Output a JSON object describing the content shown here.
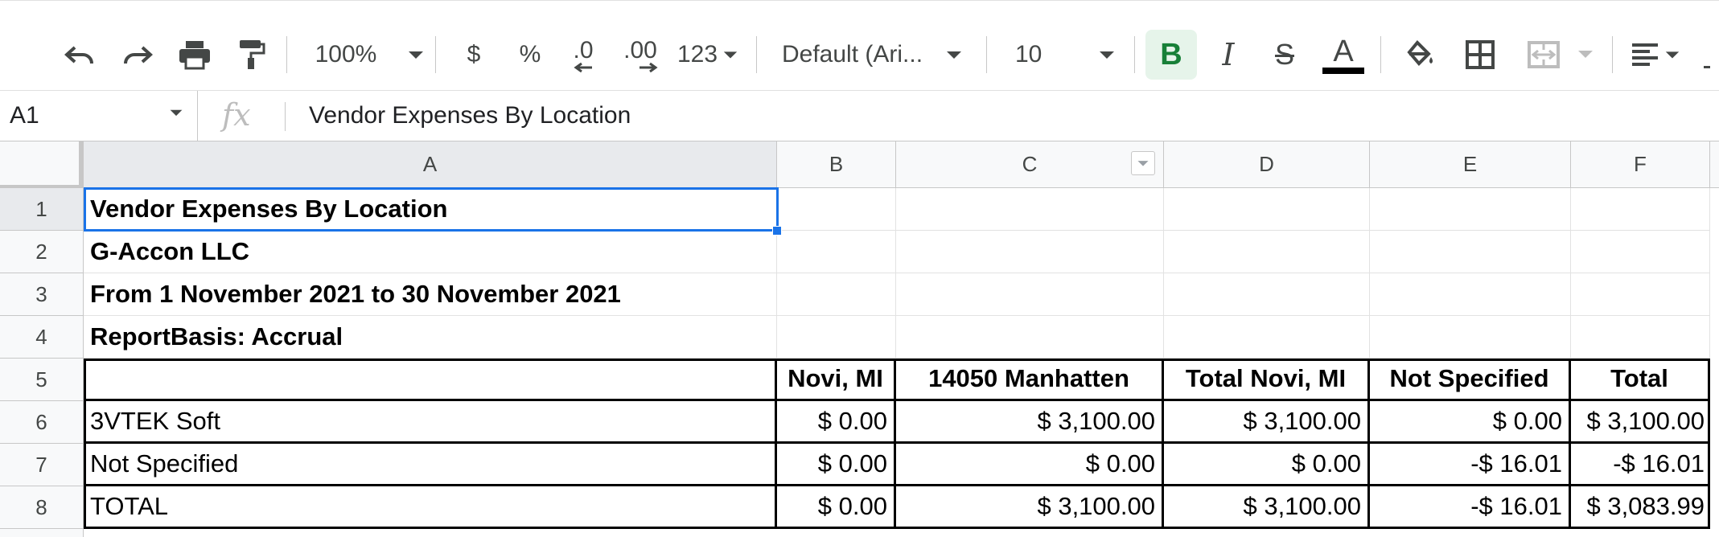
{
  "toolbar": {
    "zoom": "100%",
    "currency_label": "$",
    "percent_label": "%",
    "decrease_decimal_label": ".0",
    "increase_decimal_label": ".00",
    "more_formats_label": "123",
    "font_family": "Default (Ari...",
    "font_size": "10",
    "bold_label": "B",
    "italic_label": "I",
    "strike_label": "S",
    "text_color_label": "A",
    "colors": {
      "bold_active": "#188038",
      "text_color_bar": "#000000"
    }
  },
  "formula_bar": {
    "cell_ref": "A1",
    "fx_label": "fx",
    "value": "Vendor Expenses By Location"
  },
  "columns": [
    "A",
    "B",
    "C",
    "D",
    "E",
    "F"
  ],
  "rows": [
    "1",
    "2",
    "3",
    "4",
    "5",
    "6",
    "7",
    "8"
  ],
  "sheet": {
    "title": "Vendor Expenses By Location",
    "company": "G-Accon LLC",
    "period": "From 1 November 2021 to 30 November 2021",
    "basis": "ReportBasis: Accrual",
    "headers": [
      "",
      "Novi, MI",
      "14050 Manhatten",
      "Total Novi, MI",
      "Not Specified",
      "Total"
    ],
    "data": [
      [
        "3VTEK Soft",
        "$ 0.00",
        "$ 3,100.00",
        "$ 3,100.00",
        "$ 0.00",
        "$ 3,100.00"
      ],
      [
        "Not Specified",
        "$ 0.00",
        "$ 0.00",
        "$ 0.00",
        "-$ 16.01",
        "-$ 16.01"
      ],
      [
        "TOTAL",
        "$ 0.00",
        "$ 3,100.00",
        "$ 3,100.00",
        "-$ 16.01",
        "$ 3,083.99"
      ]
    ]
  },
  "accent_color": "#1a73e8"
}
